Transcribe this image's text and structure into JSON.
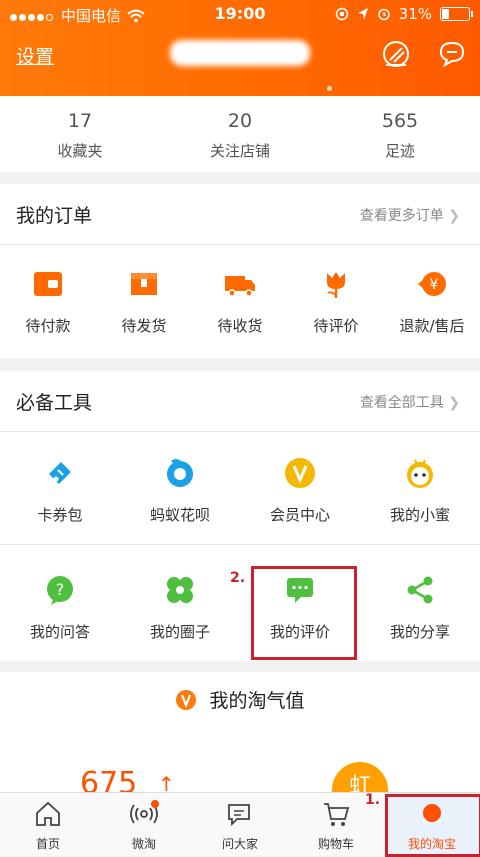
{
  "status": {
    "carrier": "中国电信",
    "time": "19:00",
    "battery": "31%"
  },
  "header": {
    "settings_label": "设置"
  },
  "stats": [
    {
      "num": "17",
      "label": "收藏夹"
    },
    {
      "num": "20",
      "label": "关注店铺"
    },
    {
      "num": "565",
      "label": "足迹"
    }
  ],
  "orders": {
    "title": "我的订单",
    "more": "查看更多订单",
    "items": [
      {
        "label": "待付款",
        "icon": "wallet-icon"
      },
      {
        "label": "待发货",
        "icon": "package-icon"
      },
      {
        "label": "待收货",
        "icon": "truck-icon"
      },
      {
        "label": "待评价",
        "icon": "tulip-icon"
      },
      {
        "label": "退款/售后",
        "icon": "refund-icon"
      }
    ]
  },
  "tools": {
    "title": "必备工具",
    "more": "查看全部工具",
    "row1": [
      {
        "label": "卡券包",
        "icon": "ticket-icon"
      },
      {
        "label": "蚂蚁花呗",
        "icon": "huabei-icon"
      },
      {
        "label": "会员中心",
        "icon": "vip-icon"
      },
      {
        "label": "我的小蜜",
        "icon": "assistant-icon"
      }
    ],
    "row2": [
      {
        "label": "我的问答",
        "icon": "question-icon"
      },
      {
        "label": "我的圈子",
        "icon": "circle-icon"
      },
      {
        "label": "我的评价",
        "icon": "comment-icon"
      },
      {
        "label": "我的分享",
        "icon": "share-icon"
      }
    ]
  },
  "taoqi": {
    "title": "我的淘气值",
    "score": "675",
    "badge": "虹"
  },
  "tabbar": [
    {
      "label": "首页",
      "icon": "home-icon"
    },
    {
      "label": "微淘",
      "icon": "weitao-icon"
    },
    {
      "label": "问大家",
      "icon": "chat-icon"
    },
    {
      "label": "购物车",
      "icon": "cart-icon"
    },
    {
      "label": "我的淘宝",
      "icon": "my-taobao-icon"
    }
  ],
  "annotations": {
    "step1": "1.",
    "step2": "2."
  },
  "colors": {
    "accent": "#ff5000",
    "header": "#ff6a00",
    "highlight": "#c8232c"
  }
}
